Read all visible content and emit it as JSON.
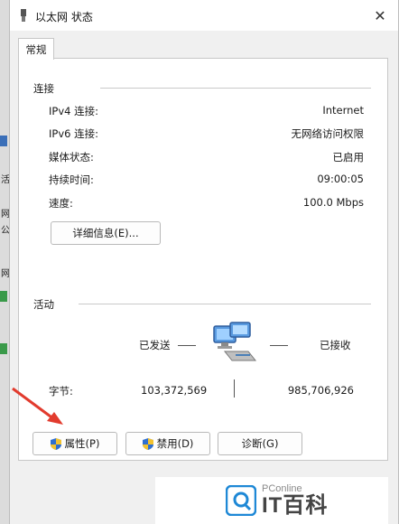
{
  "window": {
    "title": "以太网 状态",
    "close_glyph": "✕"
  },
  "tab": {
    "label": "常规"
  },
  "connection": {
    "heading": "连接",
    "rows": [
      {
        "label": "IPv4 连接:",
        "value": "Internet"
      },
      {
        "label": "IPv6 连接:",
        "value": "无网络访问权限"
      },
      {
        "label": "媒体状态:",
        "value": "已启用"
      },
      {
        "label": "持续时间:",
        "value": "09:00:05"
      },
      {
        "label": "速度:",
        "value": "100.0 Mbps"
      }
    ],
    "details_button": "详细信息(E)..."
  },
  "activity": {
    "heading": "活动",
    "sent_label": "已发送",
    "received_label": "已接收",
    "bytes_label": "字节:",
    "bytes_sent": "103,372,569",
    "bytes_received": "985,706,926"
  },
  "buttons": {
    "properties": "属性(P)",
    "disable": "禁用(D)",
    "diagnose": "诊断(G)"
  },
  "left_strip_glyphs": [
    "活",
    "网",
    "公",
    "网"
  ],
  "watermark": {
    "small": "PConline",
    "big": "IT百科"
  },
  "colors": {
    "arrow": "#e23b2e",
    "watermark_accent": "#1e88d6",
    "shield_blue": "#2f6fd0",
    "shield_yellow": "#f2c230"
  }
}
